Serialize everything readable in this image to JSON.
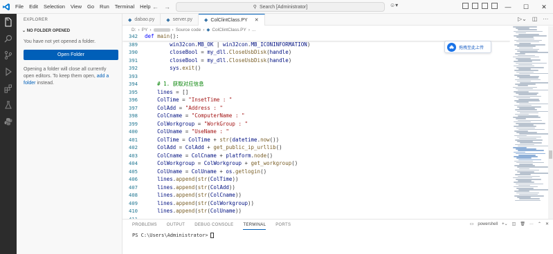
{
  "menu": [
    "File",
    "Edit",
    "Selection",
    "View",
    "Go",
    "Run",
    "Terminal",
    "Help"
  ],
  "search": {
    "text": "Search [Administrator]"
  },
  "sidebar": {
    "title": "EXPLORER",
    "section": "NO FOLDER OPENED",
    "message": "You have not yet opened a folder.",
    "open_button": "Open Folder",
    "message2": "Opening a folder will close all currently open editors. To keep them open,",
    "link": "add a folder",
    "message2_end": "instead."
  },
  "tabs": [
    {
      "label": "dabao.py",
      "active": false
    },
    {
      "label": "server.py",
      "active": false
    },
    {
      "label": "ColClintClass.PY",
      "active": true
    }
  ],
  "breadcrumb": {
    "drive": "D:",
    "part1": "PY",
    "part3": "Source code",
    "file": "ColClintClass.PY",
    "more": "..."
  },
  "float_widget": {
    "label": "拖拽至此上传"
  },
  "code_lines": [
    {
      "n": "342",
      "sticky": true,
      "tokens": [
        [
          "kw",
          "def "
        ],
        [
          "fn",
          "main"
        ],
        [
          "src",
          "():"
        ]
      ]
    },
    {
      "n": "389",
      "tokens": [
        [
          "src",
          "        "
        ],
        [
          "var",
          "win32con"
        ],
        [
          "src",
          "."
        ],
        [
          "var",
          "MB_OK"
        ],
        [
          "src",
          " | "
        ],
        [
          "var",
          "win32con"
        ],
        [
          "src",
          "."
        ],
        [
          "var",
          "MB_ICONINFORMATION"
        ],
        [
          "src",
          ")"
        ]
      ]
    },
    {
      "n": "390",
      "tokens": [
        [
          "src",
          "        "
        ],
        [
          "var",
          "closeBool"
        ],
        [
          "src",
          " = "
        ],
        [
          "var",
          "my_dll"
        ],
        [
          "src",
          "."
        ],
        [
          "fn",
          "CloseUsbDisk"
        ],
        [
          "src",
          "("
        ],
        [
          "var",
          "handle"
        ],
        [
          "src",
          ")"
        ]
      ]
    },
    {
      "n": "391",
      "tokens": [
        [
          "src",
          "        "
        ],
        [
          "var",
          "closeBool"
        ],
        [
          "src",
          " = "
        ],
        [
          "var",
          "my_dll"
        ],
        [
          "src",
          "."
        ],
        [
          "fn",
          "CloseUsbDisk"
        ],
        [
          "src",
          "("
        ],
        [
          "var",
          "handle"
        ],
        [
          "src",
          ")"
        ]
      ]
    },
    {
      "n": "392",
      "tokens": [
        [
          "src",
          "        "
        ],
        [
          "var",
          "sys"
        ],
        [
          "src",
          "."
        ],
        [
          "fn",
          "exit"
        ],
        [
          "src",
          "()"
        ]
      ]
    },
    {
      "n": "393",
      "tokens": [
        [
          "src",
          ""
        ]
      ]
    },
    {
      "n": "394",
      "tokens": [
        [
          "src",
          "    "
        ],
        [
          "cm",
          "# 1. 获取对应信息"
        ]
      ]
    },
    {
      "n": "395",
      "tokens": [
        [
          "src",
          "    "
        ],
        [
          "var",
          "lines"
        ],
        [
          "src",
          " = []"
        ]
      ]
    },
    {
      "n": "396",
      "tokens": [
        [
          "src",
          "    "
        ],
        [
          "var",
          "ColTime"
        ],
        [
          "src",
          " = "
        ],
        [
          "str",
          "\"InsetTime : \""
        ]
      ]
    },
    {
      "n": "397",
      "tokens": [
        [
          "src",
          "    "
        ],
        [
          "var",
          "ColAdd"
        ],
        [
          "src",
          " = "
        ],
        [
          "str",
          "\"Address : \""
        ]
      ]
    },
    {
      "n": "398",
      "tokens": [
        [
          "src",
          "    "
        ],
        [
          "var",
          "ColCname"
        ],
        [
          "src",
          " = "
        ],
        [
          "str",
          "\"ComputerName : \""
        ]
      ]
    },
    {
      "n": "399",
      "tokens": [
        [
          "src",
          "    "
        ],
        [
          "var",
          "ColWorkgroup"
        ],
        [
          "src",
          " = "
        ],
        [
          "str",
          "\"WorkGroup : \""
        ]
      ]
    },
    {
      "n": "400",
      "tokens": [
        [
          "src",
          "    "
        ],
        [
          "var",
          "ColUname"
        ],
        [
          "src",
          " = "
        ],
        [
          "str",
          "\"UseName : \""
        ]
      ]
    },
    {
      "n": "401",
      "tokens": [
        [
          "src",
          "    "
        ],
        [
          "var",
          "ColTime"
        ],
        [
          "src",
          " = "
        ],
        [
          "var",
          "ColTime"
        ],
        [
          "src",
          " + "
        ],
        [
          "fn",
          "str"
        ],
        [
          "src",
          "("
        ],
        [
          "var",
          "datetime"
        ],
        [
          "src",
          "."
        ],
        [
          "fn",
          "now"
        ],
        [
          "src",
          "())"
        ]
      ]
    },
    {
      "n": "402",
      "tokens": [
        [
          "src",
          "    "
        ],
        [
          "var",
          "ColAdd"
        ],
        [
          "src",
          " = "
        ],
        [
          "var",
          "ColAdd"
        ],
        [
          "src",
          " + "
        ],
        [
          "fn",
          "get_public_ip_urllib"
        ],
        [
          "src",
          "()"
        ]
      ]
    },
    {
      "n": "403",
      "tokens": [
        [
          "src",
          "    "
        ],
        [
          "var",
          "ColCname"
        ],
        [
          "src",
          " = "
        ],
        [
          "var",
          "ColCname"
        ],
        [
          "src",
          " + "
        ],
        [
          "var",
          "platform"
        ],
        [
          "src",
          "."
        ],
        [
          "fn",
          "node"
        ],
        [
          "src",
          "()"
        ]
      ]
    },
    {
      "n": "404",
      "tokens": [
        [
          "src",
          "    "
        ],
        [
          "var",
          "ColWorkgroup"
        ],
        [
          "src",
          " = "
        ],
        [
          "var",
          "ColWorkgroup"
        ],
        [
          "src",
          " + "
        ],
        [
          "fn",
          "get_workgroup"
        ],
        [
          "src",
          "()"
        ]
      ]
    },
    {
      "n": "405",
      "tokens": [
        [
          "src",
          "    "
        ],
        [
          "var",
          "ColUname"
        ],
        [
          "src",
          " = "
        ],
        [
          "var",
          "ColUname"
        ],
        [
          "src",
          " + "
        ],
        [
          "var",
          "os"
        ],
        [
          "src",
          "."
        ],
        [
          "fn",
          "getlogin"
        ],
        [
          "src",
          "()"
        ]
      ]
    },
    {
      "n": "406",
      "tokens": [
        [
          "src",
          "    "
        ],
        [
          "var",
          "lines"
        ],
        [
          "src",
          "."
        ],
        [
          "fn",
          "append"
        ],
        [
          "src",
          "("
        ],
        [
          "fn",
          "str"
        ],
        [
          "src",
          "("
        ],
        [
          "var",
          "ColTime"
        ],
        [
          "src",
          "))"
        ]
      ]
    },
    {
      "n": "407",
      "tokens": [
        [
          "src",
          "    "
        ],
        [
          "var",
          "lines"
        ],
        [
          "src",
          "."
        ],
        [
          "fn",
          "append"
        ],
        [
          "src",
          "("
        ],
        [
          "fn",
          "str"
        ],
        [
          "src",
          "("
        ],
        [
          "var",
          "ColAdd"
        ],
        [
          "src",
          "))"
        ]
      ]
    },
    {
      "n": "408",
      "tokens": [
        [
          "src",
          "    "
        ],
        [
          "var",
          "lines"
        ],
        [
          "src",
          "."
        ],
        [
          "fn",
          "append"
        ],
        [
          "src",
          "("
        ],
        [
          "fn",
          "str"
        ],
        [
          "src",
          "("
        ],
        [
          "var",
          "ColCname"
        ],
        [
          "src",
          "))"
        ]
      ]
    },
    {
      "n": "409",
      "tokens": [
        [
          "src",
          "    "
        ],
        [
          "var",
          "lines"
        ],
        [
          "src",
          "."
        ],
        [
          "fn",
          "append"
        ],
        [
          "src",
          "("
        ],
        [
          "fn",
          "str"
        ],
        [
          "src",
          "("
        ],
        [
          "var",
          "ColWorkgroup"
        ],
        [
          "src",
          "))"
        ]
      ]
    },
    {
      "n": "410",
      "tokens": [
        [
          "src",
          "    "
        ],
        [
          "var",
          "lines"
        ],
        [
          "src",
          "."
        ],
        [
          "fn",
          "append"
        ],
        [
          "src",
          "("
        ],
        [
          "fn",
          "str"
        ],
        [
          "src",
          "("
        ],
        [
          "var",
          "ColUname"
        ],
        [
          "src",
          "))"
        ]
      ]
    },
    {
      "n": "411",
      "tokens": [
        [
          "src",
          ""
        ]
      ]
    }
  ],
  "panel": {
    "tabs": [
      "PROBLEMS",
      "OUTPUT",
      "DEBUG CONSOLE",
      "TERMINAL",
      "PORTS"
    ],
    "active_tab": "TERMINAL",
    "shell": "powershell",
    "prompt": "PS C:\\Users\\Administrator> "
  },
  "colors": {
    "accent": "#005fb8",
    "activity_bar": "#2c2c2c"
  }
}
